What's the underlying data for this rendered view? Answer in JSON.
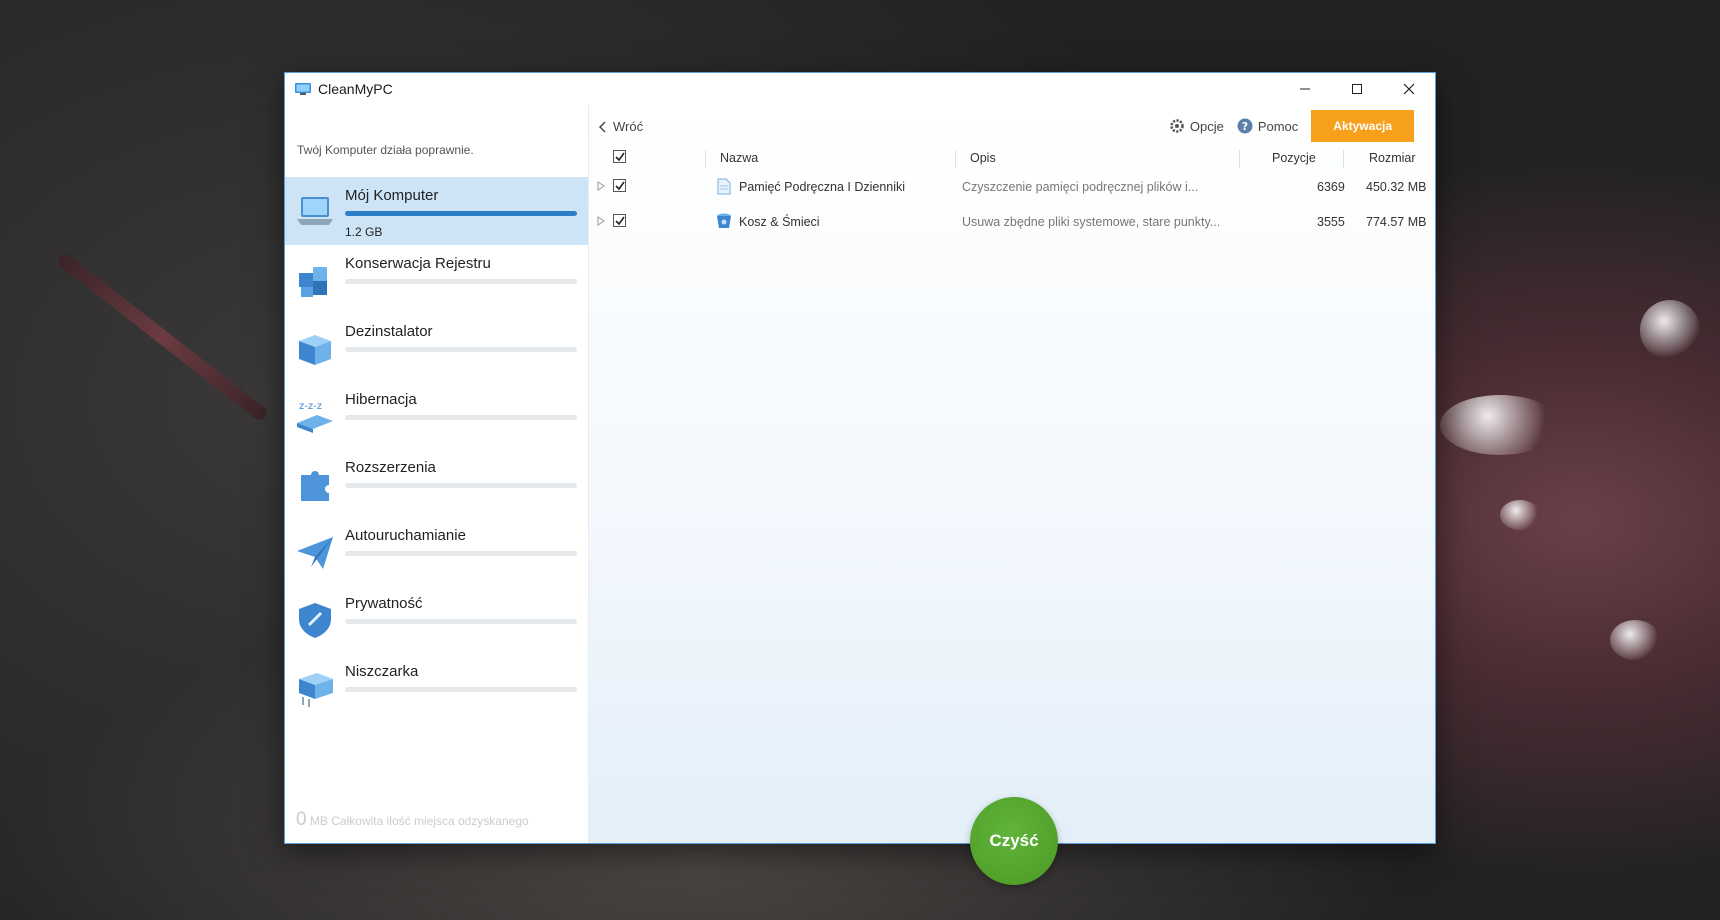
{
  "window": {
    "title": "CleanMyPC"
  },
  "sidebar": {
    "status": "Twój Komputer działa poprawnie.",
    "items": [
      {
        "label": "Mój Komputer",
        "size": "1.2 GB",
        "icon": "laptop-icon",
        "progress": 1.0,
        "active": true
      },
      {
        "label": "Konserwacja Rejestru",
        "icon": "registry-cubes-icon",
        "progress": 0
      },
      {
        "label": "Dezinstalator",
        "icon": "box-icon",
        "progress": 0
      },
      {
        "label": "Hibernacja",
        "icon": "sleep-icon",
        "progress": 0
      },
      {
        "label": "Rozszerzenia",
        "icon": "puzzle-icon",
        "progress": 0
      },
      {
        "label": "Autouruchamianie",
        "icon": "paper-plane-icon",
        "progress": 0
      },
      {
        "label": "Prywatność",
        "icon": "shield-icon",
        "progress": 0
      },
      {
        "label": "Niszczarka",
        "icon": "shredder-icon",
        "progress": 0
      }
    ],
    "reclaimed_value": "0",
    "reclaimed_label": "MB Całkowita ilość miejsca odzyskanego"
  },
  "toolbar": {
    "back": "Wróć",
    "options": "Opcje",
    "help": "Pomoc",
    "activate": "Aktywacja"
  },
  "table": {
    "columns": [
      "Nazwa",
      "Opis",
      "Pozycje",
      "Rozmiar"
    ],
    "rows": [
      {
        "name": "Pamięć Podręczna I Dzienniki",
        "description": "Czyszczenie pamięci podręcznej plików i...",
        "items": "6369",
        "size": "450.32 MB",
        "checked": true,
        "icon": "document-icon"
      },
      {
        "name": "Kosz & Śmieci",
        "description": "Usuwa zbędne pliki systemowe, stare punkty...",
        "items": "3555",
        "size": "774.57 MB",
        "checked": true,
        "icon": "trash-bin-icon"
      }
    ]
  },
  "clean_button": "Czyść",
  "colors": {
    "accent": "#2b7fc9",
    "activate": "#f7a01c",
    "clean": "#4fa22a",
    "active_item": "#cde4f7"
  }
}
